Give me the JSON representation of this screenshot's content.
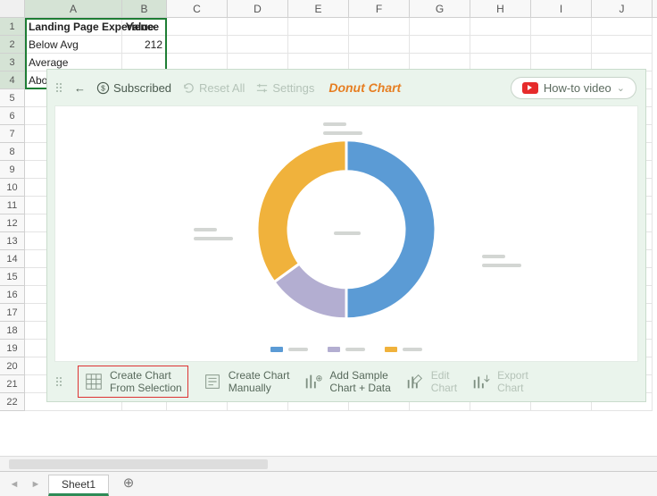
{
  "columns": [
    "A",
    "B",
    "C",
    "D",
    "E",
    "F",
    "G",
    "H",
    "I",
    "J"
  ],
  "row_count": 22,
  "selected_cols": [
    "A",
    "B"
  ],
  "selected_rows": [
    1,
    2,
    3,
    4
  ],
  "cells": {
    "A1": {
      "v": "Landing Page Experience",
      "bold": true
    },
    "B1": {
      "v": "Value",
      "bold": true
    },
    "A2": {
      "v": "Below Avg"
    },
    "B2": {
      "v": "212",
      "num": true
    },
    "A3": {
      "v": "Average"
    },
    "A4": {
      "v": "Above Avg"
    }
  },
  "panel": {
    "back_label": "←",
    "subscribed_label": "Subscribed",
    "reset_label": "Reset All",
    "settings_label": "Settings",
    "title": "Donut Chart",
    "howto_label": "How-to video",
    "buttons": {
      "create_selection": "Create Chart\nFrom Selection",
      "create_manual": "Create Chart\nManually",
      "add_sample": "Add Sample\nChart + Data",
      "edit": "Edit\nChart",
      "export": "Export\nChart"
    }
  },
  "chart_data": {
    "type": "donut",
    "title": "",
    "series": [
      {
        "name": "Blue",
        "value": 50,
        "color": "#5b9bd5"
      },
      {
        "name": "Purple",
        "value": 15,
        "color": "#b3aed1"
      },
      {
        "name": "Orange",
        "value": 35,
        "color": "#f0b23c"
      }
    ],
    "inner_radius_pct": 65
  },
  "sheet": {
    "active_tab": "Sheet1"
  }
}
